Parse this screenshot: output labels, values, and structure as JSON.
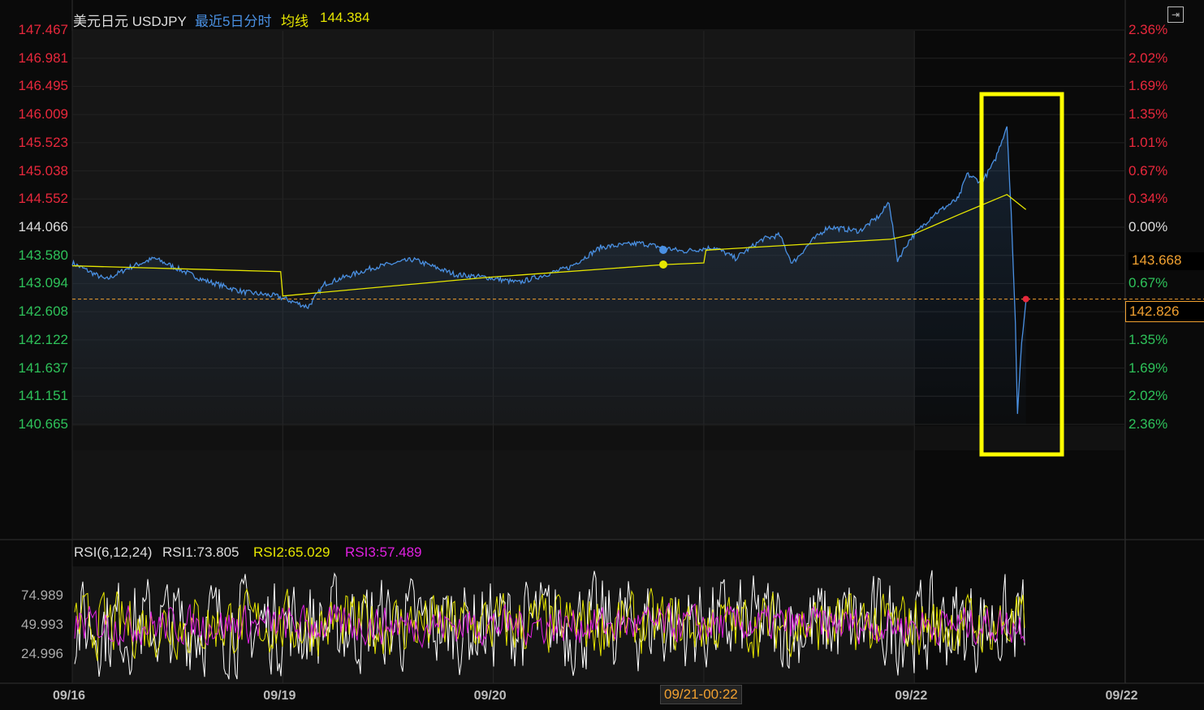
{
  "header": {
    "name": "美元日元 USDJPY",
    "period": "最近5日分时",
    "avg_label": "均线",
    "avg_value": "144.384"
  },
  "colors": {
    "price": "#4a90e2",
    "avg": "#e6e600",
    "up": "#e8283c",
    "down": "#2ec25a",
    "orange": "#f0a030",
    "rsi1": "#ffffff",
    "rsi2": "#e6e600",
    "rsi3": "#e020e0",
    "highlight": "#ffff00"
  },
  "chart_data": [
    {
      "type": "line",
      "title": "美元日元 USDJPY 最近5日分时",
      "x_unit": "trading days since 09/16",
      "xlim": [
        0,
        5
      ],
      "ylim": [
        140.665,
        147.467
      ],
      "y_ticks_left": [
        "147.467",
        "146.981",
        "146.495",
        "146.009",
        "145.523",
        "145.038",
        "144.552",
        "144.066",
        "143.580",
        "143.094",
        "142.608",
        "142.122",
        "141.637",
        "141.151",
        "140.665"
      ],
      "y_ticks_right": [
        "2.36%",
        "2.02%",
        "1.69%",
        "1.35%",
        "1.01%",
        "0.67%",
        "0.34%",
        "0.00%",
        "",
        "0.67%",
        "",
        "1.35%",
        "1.69%",
        "2.02%",
        "2.36%"
      ],
      "x_ticks": [
        {
          "d": 0,
          "label": "09/16"
        },
        {
          "d": 1,
          "label": "09/19"
        },
        {
          "d": 2,
          "label": "09/20"
        },
        {
          "d": 4,
          "label": "09/22"
        },
        {
          "d": 5,
          "label": "09/22"
        }
      ],
      "crosshair_label": "09/21-00:22",
      "last_price": "142.826",
      "cursor_price": "143.668",
      "series": [
        {
          "name": "price",
          "x": [
            0,
            0.16,
            0.27,
            0.39,
            0.62,
            0.81,
            0.97,
            1.12,
            1.2,
            1.43,
            1.62,
            1.82,
            1.97,
            2.12,
            2.36,
            2.51,
            2.7,
            2.9,
            3.05,
            3.15,
            3.28,
            3.36,
            3.42,
            3.51,
            3.59,
            3.74,
            3.84,
            3.88,
            3.92,
            3.98,
            4.09,
            4.21,
            4.25,
            4.32,
            4.38,
            4.44,
            4.46,
            4.48,
            4.49,
            4.51,
            4.53
          ],
          "y": [
            143.45,
            143.16,
            143.37,
            143.53,
            143.16,
            142.95,
            142.88,
            142.69,
            143.09,
            143.37,
            143.51,
            143.25,
            143.2,
            143.11,
            143.37,
            143.72,
            143.79,
            143.65,
            143.72,
            143.53,
            143.86,
            143.93,
            143.44,
            143.82,
            144.07,
            144.0,
            144.28,
            144.51,
            143.5,
            143.86,
            144.28,
            144.56,
            144.98,
            144.84,
            145.19,
            145.82,
            144.35,
            142.39,
            140.85,
            142.11,
            142.78
          ]
        },
        {
          "name": "均线",
          "x": [
            0,
            0.99,
            1.0,
            1.97,
            2.81,
            3.0,
            3.01,
            3.89,
            4.0,
            4.21,
            4.44,
            4.53
          ],
          "y": [
            143.4,
            143.3,
            142.88,
            143.2,
            143.42,
            143.45,
            143.67,
            143.86,
            143.95,
            144.28,
            144.63,
            144.37
          ]
        }
      ]
    },
    {
      "type": "line",
      "title": "RSI(6,12,24)",
      "ylim": [
        0,
        100
      ],
      "y_ticks": [
        "74.989",
        "49.993",
        "24.996"
      ],
      "series": [
        {
          "name": "RSI1",
          "label": "RSI1:73.805",
          "last": 73.805
        },
        {
          "name": "RSI2",
          "label": "RSI2:65.029",
          "last": 65.029
        },
        {
          "name": "RSI3",
          "label": "RSI3:57.489",
          "last": 57.489
        }
      ]
    }
  ]
}
